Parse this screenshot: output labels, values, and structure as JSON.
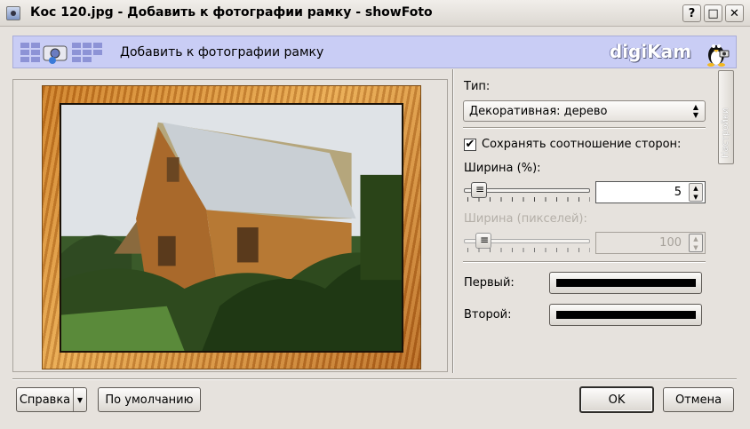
{
  "window": {
    "title": "Кос 120.jpg - Добавить к фотографии рамку - showFoto",
    "help_button": "?",
    "maximize_button": "□",
    "close_button": "✕"
  },
  "banner": {
    "title": "Добавить к фотографии рамку",
    "logo": "digiKam"
  },
  "settings": {
    "type_label": "Тип:",
    "type_value": "Декоративная: дерево",
    "keep_ratio_label": "Сохранять соотношение сторон:",
    "keep_ratio_checked": "✔",
    "width_percent_label": "Ширина (%):",
    "width_percent_value": "5",
    "width_percent_slider": 0.05,
    "width_pixels_label": "Ширина (пикселей):",
    "width_pixels_value": "100",
    "first_label": "Первый:",
    "first_color": "#000000",
    "second_label": "Второй:",
    "second_color": "#000000",
    "side_tab_label": "Настройки"
  },
  "buttons": {
    "help": "Справка",
    "defaults": "По умолчанию",
    "ok": "OK",
    "cancel": "Отмена"
  }
}
